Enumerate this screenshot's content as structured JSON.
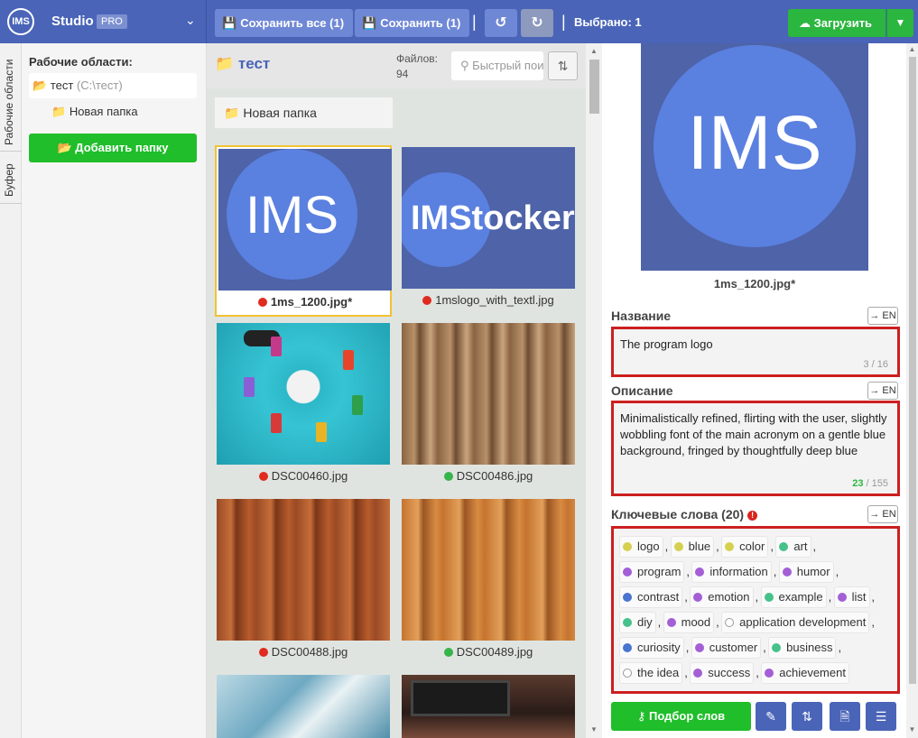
{
  "brand": {
    "logo": "IMS",
    "name": "Studio",
    "pro": "PRO"
  },
  "toolbar": {
    "save_all": "Сохранить все (1)",
    "save": "Сохранить (1)",
    "undo_icon": "undo-icon",
    "redo_icon": "redo-icon",
    "selected": "Выбрано: 1",
    "upload": "Загрузить"
  },
  "sidetabs": [
    "Рабочие области",
    "Буфер"
  ],
  "workspace": {
    "title": "Рабочие области:",
    "item_name": "тест",
    "item_path": "(C:\\тест)",
    "subfolder": "Новая папка",
    "add_folder": "Добавить папку"
  },
  "browser": {
    "title": "тест",
    "count_label": "Файлов:",
    "count": "94",
    "search_placeholder": "Быстрый поиск",
    "folder": "Новая папка",
    "files": [
      {
        "name": "1ms_1200.jpg*",
        "status": "red"
      },
      {
        "name": "1mslogo_with_textl.jpg",
        "status": "red"
      },
      {
        "name": "DSC00460.jpg",
        "status": "red"
      },
      {
        "name": "DSC00486.jpg",
        "status": "green"
      },
      {
        "name": "DSC00488.jpg",
        "status": "red"
      },
      {
        "name": "DSC00489.jpg",
        "status": "green"
      }
    ],
    "thumb_text_1": "IMS",
    "thumb_text_2": "IMStocker"
  },
  "preview": {
    "image_text": "IMS",
    "filename": "1ms_1200.jpg*"
  },
  "details": {
    "title_label": "Название",
    "title_value": "The program logo",
    "title_count": "3 / 16",
    "desc_label": "Описание",
    "desc_value": "Minimalistically refined, flirting with the user, slightly wobbling font of the main acronym on a gentle blue background, fringed by thoughtfully deep blue",
    "desc_count_current": "23",
    "desc_count_max": " / 155",
    "kw_label": "Ключевые слова (20)",
    "en_label": "→ EN",
    "keywords": [
      [
        {
          "w": "logo",
          "c": "#d6d04f"
        },
        {
          "w": "blue",
          "c": "#d6d04f"
        },
        {
          "w": "color",
          "c": "#d6d04f"
        },
        {
          "w": "art",
          "c": "#47c18a"
        }
      ],
      [
        {
          "w": "program",
          "c": "#a45fd6"
        },
        {
          "w": "information",
          "c": "#a45fd6"
        },
        {
          "w": "humor",
          "c": "#a45fd6"
        }
      ],
      [
        {
          "w": "contrast",
          "c": "#4a74d0"
        },
        {
          "w": "emotion",
          "c": "#a45fd6"
        },
        {
          "w": "example",
          "c": "#47c18a"
        },
        {
          "w": "list",
          "c": "#a45fd6"
        }
      ],
      [
        {
          "w": "diy",
          "c": "#47c18a"
        },
        {
          "w": "mood",
          "c": "#a45fd6"
        },
        {
          "w": "application development",
          "c": "#ffffff"
        }
      ],
      [
        {
          "w": "curiosity",
          "c": "#4a74d0"
        },
        {
          "w": "customer",
          "c": "#a45fd6"
        },
        {
          "w": "business",
          "c": "#47c18a"
        }
      ],
      [
        {
          "w": "the idea",
          "c": "#ffffff"
        },
        {
          "w": "success",
          "c": "#a45fd6"
        },
        {
          "w": "achievement",
          "c": "#a45fd6"
        }
      ]
    ],
    "pick_words": "Подбор слов"
  }
}
